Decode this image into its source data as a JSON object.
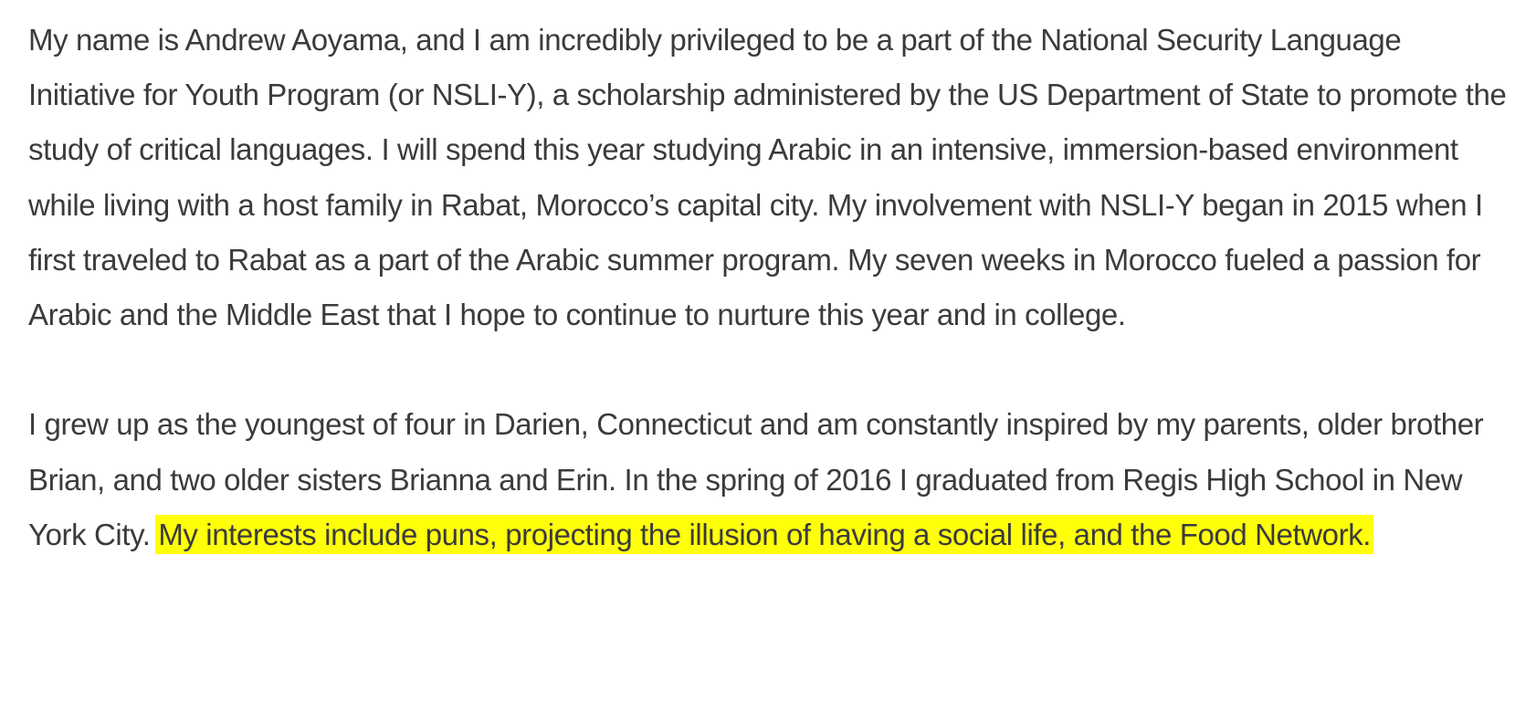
{
  "article": {
    "paragraph_1": "My name is Andrew Aoyama, and I am incredibly privileged to be a part of the National Security Language Initiative for Youth Program (or NSLI-Y), a scholarship administered by the US Department of State to promote the study of critical languages. I will spend this year studying Arabic in an intensive, immersion-based environment while living with a host family in Rabat, Morocco’s capital city. My involvement with NSLI-Y began in 2015 when I first traveled to Rabat as a part of the Arabic summer program. My seven weeks in Morocco fueled a passion for Arabic and the Middle East that I hope to continue to nurture this year and in college.",
    "paragraph_2_plain": "I grew up as the youngest of four in Darien, Connecticut and am constantly inspired by my parents, older brother Brian, and two older sisters Brianna and Erin. In the spring of 2016 I graduated from Regis High School in New York City. ",
    "paragraph_2_highlighted": "My interests include puns, projecting the illusion of having a social life, and the Food Network."
  },
  "colors": {
    "text": "#3b3b3b",
    "highlight": "#ffff0a",
    "background": "#ffffff"
  }
}
